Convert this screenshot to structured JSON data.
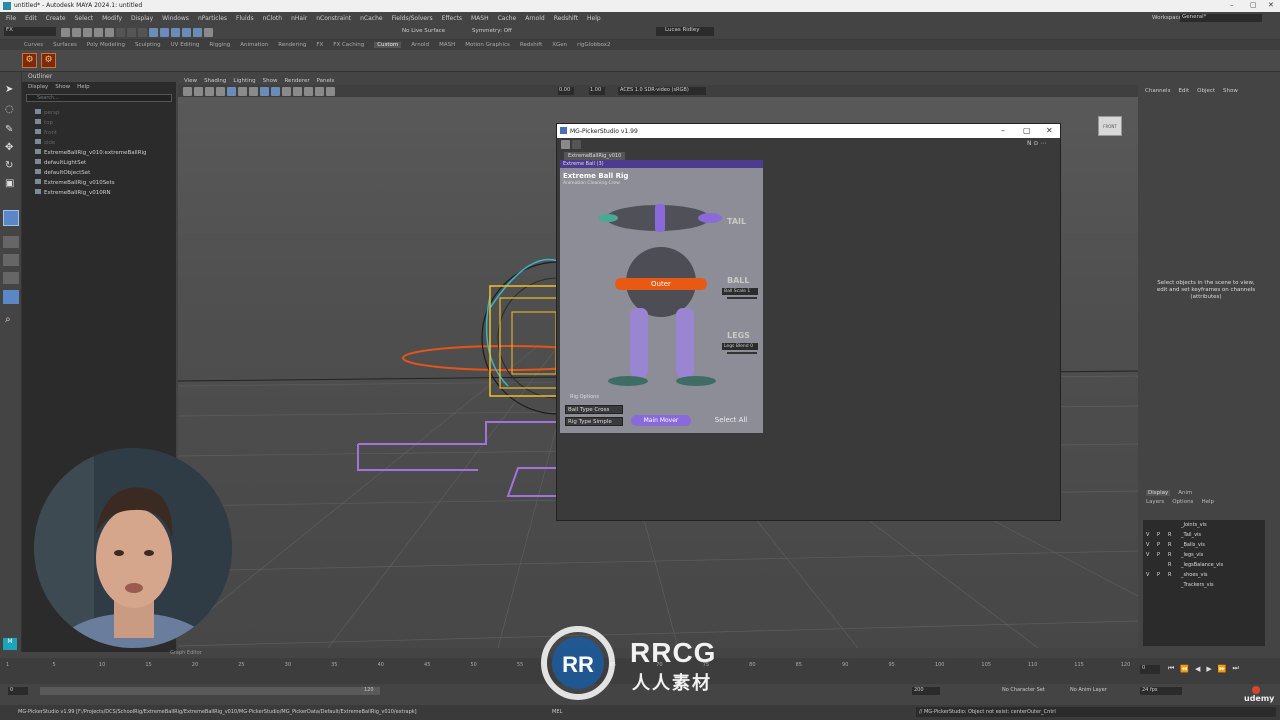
{
  "window": {
    "title": "untitled* - Autodesk MAYA 2024.1: untitled"
  },
  "menubar": {
    "items": [
      "File",
      "Edit",
      "Create",
      "Select",
      "Modify",
      "Display",
      "Windows",
      "nParticles",
      "Fluids",
      "nCloth",
      "nHair",
      "nConstraint",
      "nCache",
      "Fields/Solvers",
      "Effects",
      "MASH",
      "Cache",
      "Arnold",
      "Redshift",
      "Help"
    ],
    "workspace_label": "Workspace:",
    "workspace_value": "General*"
  },
  "toolbar": {
    "mode": "FX",
    "live_surface": "No Live Surface",
    "symmetry": "Symmetry: Off",
    "user": "Lucas Ridley"
  },
  "shelf": {
    "tabs": [
      "Curves",
      "Surfaces",
      "Poly Modeling",
      "Sculpting",
      "UV Editing",
      "Rigging",
      "Animation",
      "Rendering",
      "FX",
      "FX Caching",
      "Custom",
      "Arnold",
      "MASH",
      "Motion Graphics",
      "Redshift",
      "XGen",
      "rigGlobbox2"
    ],
    "active_tab": "Custom"
  },
  "outliner": {
    "title": "Outliner",
    "menu": [
      "Display",
      "Show",
      "Help"
    ],
    "search_placeholder": "Search...",
    "items": [
      {
        "label": "persp",
        "dim": true
      },
      {
        "label": "top",
        "dim": true
      },
      {
        "label": "front",
        "dim": true
      },
      {
        "label": "side",
        "dim": true
      },
      {
        "label": "ExtremeBallRig_v010:extremeBallRig",
        "dim": false
      },
      {
        "label": "defaultLightSet",
        "dim": false
      },
      {
        "label": "defaultObjectSet",
        "dim": false
      },
      {
        "label": "ExtremeBallRig_v010Sets",
        "dim": false
      },
      {
        "label": "ExtremeBallRig_v010RN",
        "dim": false
      }
    ]
  },
  "viewport": {
    "menu": [
      "View",
      "Shading",
      "Lighting",
      "Show",
      "Renderer",
      "Panels"
    ],
    "field1": "0.00",
    "field2": "1.00",
    "colorspace": "ACES 1.0 SDR-video (sRGB)",
    "viewcube_label": "FRONT"
  },
  "channelbox": {
    "menu": [
      "Channels",
      "Edit",
      "Object",
      "Show"
    ],
    "message": "Select objects in the scene to view, edit and set keyframes on channels (attributes)"
  },
  "layers": {
    "tabs": [
      "Display",
      "Anim"
    ],
    "menu": [
      "Layers",
      "Options",
      "Help"
    ],
    "rows": [
      {
        "v": "",
        "p": "",
        "r": "",
        "name": "_Joints_vis"
      },
      {
        "v": "V",
        "p": "P",
        "r": "R",
        "name": "_Tail_vis"
      },
      {
        "v": "V",
        "p": "P",
        "r": "R",
        "name": "_Balls_vis"
      },
      {
        "v": "V",
        "p": "P",
        "r": "R",
        "name": "_legs_vis"
      },
      {
        "v": "",
        "p": "",
        "r": "R",
        "name": "_legsBalance_vis"
      },
      {
        "v": "V",
        "p": "P",
        "r": "R",
        "name": "_shoes_vis"
      },
      {
        "v": "",
        "p": "",
        "r": "",
        "name": "_Trackers_vis"
      }
    ]
  },
  "picker": {
    "title": "MG-PickerStudio v1.99",
    "tab": "ExtremeBallRig_v010",
    "panel_header": "Extreme Ball (3)",
    "rig_title": "Extreme Ball Rig",
    "rig_subtitle": "Animation Cleaning Crew",
    "tail_label": "TAIL",
    "ball_label": "BALL",
    "legs_label": "LEGS",
    "ball_scale": "Ball Scale  1",
    "legs_blend": "Legs Blend  0",
    "outer_button": "Outer",
    "rig_options": "Rig Options",
    "ball_type": "Ball Type  Cross",
    "rig_type": "Rig Type  Simple",
    "main_mover": "Main Mover",
    "select_all": "Select All",
    "accent_purple": "#8a6ad8",
    "accent_orange": "#e85a13"
  },
  "timeline": {
    "ticks": [
      "1",
      "5",
      "10",
      "15",
      "20",
      "25",
      "30",
      "35",
      "40",
      "45",
      "50",
      "55",
      "60",
      "65",
      "70",
      "75",
      "80",
      "85",
      "90",
      "95",
      "100",
      "105",
      "110",
      "115",
      "120"
    ],
    "current_frame": "0",
    "range_start": "0",
    "range_end": "200",
    "range_inner_end": "120",
    "no_character_set": "No Character Set",
    "no_anim_layer": "No Anim Layer",
    "fps": "24 fps",
    "graph_editor": "Graph Editor"
  },
  "commandline": {
    "history": "MG-PickerStudio v1.99 [F:/Projects/DCS/SchoolRig/ExtremeBallRig/ExtremeBallRig_v010/MG-PickerStudio/MG_PickerData/Default/ExtremeBallRig_v010/extrapk]",
    "mode": "MEL",
    "result": "// MG-PickerStudio: Object not exist: centerOuter_Cntrl"
  },
  "branding": {
    "watermark_main": "RRCG",
    "watermark_sub": "人人素材",
    "udemy": "udemy"
  }
}
